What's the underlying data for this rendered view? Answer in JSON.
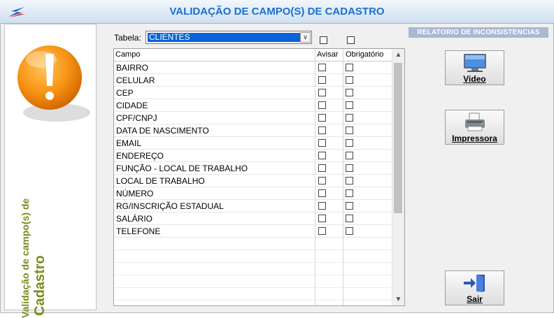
{
  "window": {
    "title": "VALIDAÇÃO DE CAMPO(S) DE CADASTRO"
  },
  "side": {
    "title_line1": "Validação de campo(s) de",
    "title_line2": "Cadastro"
  },
  "tabela": {
    "label": "Tabela:",
    "value": "CLIENTES"
  },
  "grid": {
    "headers": {
      "campo": "Campo",
      "avisar": "Avisar",
      "obrigatorio": "Obrigatório"
    },
    "rows": [
      {
        "campo": "BAIRRO"
      },
      {
        "campo": "CELULAR"
      },
      {
        "campo": "CEP"
      },
      {
        "campo": "CIDADE"
      },
      {
        "campo": "CPF/CNPJ"
      },
      {
        "campo": "DATA DE NASCIMENTO"
      },
      {
        "campo": "EMAIL"
      },
      {
        "campo": "ENDEREÇO"
      },
      {
        "campo": "FUNÇÃO - LOCAL DE TRABALHO"
      },
      {
        "campo": "LOCAL DE TRABALHO"
      },
      {
        "campo": "NÚMERO"
      },
      {
        "campo": "RG/INSCRIÇÃO ESTADUAL"
      },
      {
        "campo": "SALÁRIO"
      },
      {
        "campo": "TELEFONE"
      }
    ]
  },
  "report": {
    "header": "RELATORIO DE INCONSISTENCIAS",
    "video_label": "Video",
    "printer_label": "Impressora"
  },
  "exit": {
    "label": "Sair"
  },
  "colors": {
    "title_blue": "#1a6fd0",
    "side_title_olive": "#7d8a1c",
    "selection_blue": "#0a63d6",
    "report_header_bg": "#a9b9d3"
  }
}
